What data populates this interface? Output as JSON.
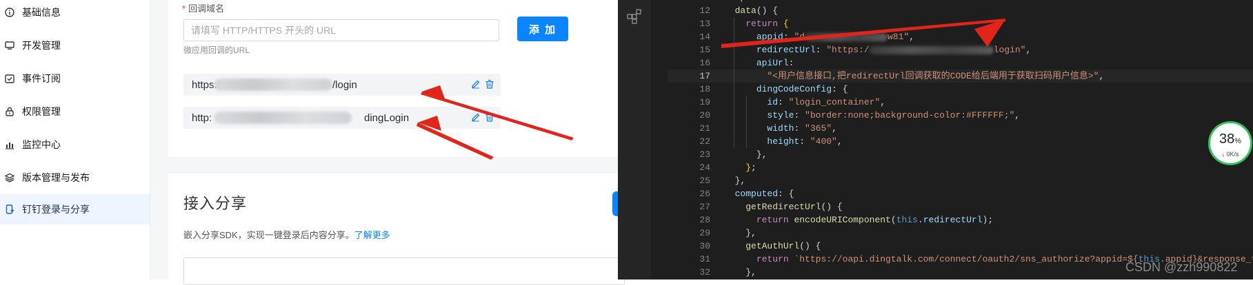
{
  "sidebar": {
    "items": [
      {
        "label": "基础信息",
        "icon": "info-icon"
      },
      {
        "label": "开发管理",
        "icon": "monitor-icon"
      },
      {
        "label": "事件订阅",
        "icon": "calendar-check-icon"
      },
      {
        "label": "权限管理",
        "icon": "lock-icon"
      },
      {
        "label": "监控中心",
        "icon": "bar-chart-icon"
      },
      {
        "label": "版本管理与发布",
        "icon": "layers-icon"
      },
      {
        "label": "钉钉登录与分享",
        "icon": "mobile-share-icon"
      }
    ],
    "active_index": 6
  },
  "callback": {
    "label": "回调域名",
    "required_mark": "*",
    "placeholder": "请填写 HTTP/HTTPS 开头的 URL",
    "add_button": "添 加",
    "hint": "微应用回调的URL",
    "urls": [
      {
        "prefix": "https:/",
        "suffix": "/login"
      },
      {
        "prefix": "http:",
        "suffix": "dingLogin"
      }
    ]
  },
  "share_section": {
    "title": "接入分享",
    "description": "嵌入分享SDK，实现一键登录后内容分享。",
    "link": "了解更多"
  },
  "editor": {
    "lines": [
      {
        "n": "12",
        "parts": [
          [
            "",
            "  "
          ],
          [
            "fn",
            "data"
          ],
          [
            "",
            "() {"
          ]
        ]
      },
      {
        "n": "13",
        "parts": [
          [
            "",
            "    "
          ],
          [
            "kw",
            "return"
          ],
          [
            "",
            " "
          ],
          [
            "br",
            "{"
          ]
        ]
      },
      {
        "n": "14",
        "parts": [
          [
            "",
            "      "
          ],
          [
            "prop",
            "appid"
          ],
          [
            "",
            ": "
          ],
          [
            "str",
            "\"d"
          ],
          [
            "blur",
            "120"
          ],
          [
            "str",
            "w81\""
          ],
          [
            "",
            ","
          ]
        ]
      },
      {
        "n": "15",
        "parts": [
          [
            "",
            "      "
          ],
          [
            "prop",
            "redirectUrl"
          ],
          [
            "",
            ": "
          ],
          [
            "str",
            "\"https:/"
          ],
          [
            "blur",
            "180"
          ],
          [
            "str",
            "login\""
          ],
          [
            "",
            ","
          ]
        ]
      },
      {
        "n": "16",
        "parts": [
          [
            "",
            "      "
          ],
          [
            "prop",
            "apiUrl"
          ],
          [
            "",
            ":"
          ]
        ]
      },
      {
        "n": "17",
        "parts": [
          [
            "",
            "        "
          ],
          [
            "str",
            "\"<用户信息接口,把redirectUrl回调获取的CODE给后端用于获取扫码用户信息>\""
          ],
          [
            "",
            ","
          ]
        ]
      },
      {
        "n": "18",
        "parts": [
          [
            "",
            "      "
          ],
          [
            "prop",
            "dingCodeConfig"
          ],
          [
            "",
            ": {"
          ]
        ]
      },
      {
        "n": "19",
        "parts": [
          [
            "",
            "        "
          ],
          [
            "prop",
            "id"
          ],
          [
            "",
            ": "
          ],
          [
            "str",
            "\"login_container\""
          ],
          [
            "",
            ","
          ]
        ]
      },
      {
        "n": "20",
        "parts": [
          [
            "",
            "        "
          ],
          [
            "prop",
            "style"
          ],
          [
            "",
            ": "
          ],
          [
            "str",
            "\"border:none;background-color:#FFFFFF;\""
          ],
          [
            "",
            ","
          ]
        ]
      },
      {
        "n": "21",
        "parts": [
          [
            "",
            "        "
          ],
          [
            "prop",
            "width"
          ],
          [
            "",
            ": "
          ],
          [
            "str",
            "\"365\""
          ],
          [
            "",
            ","
          ]
        ]
      },
      {
        "n": "22",
        "parts": [
          [
            "",
            "        "
          ],
          [
            "prop",
            "height"
          ],
          [
            "",
            ": "
          ],
          [
            "str",
            "\"400\""
          ],
          [
            "",
            ","
          ]
        ]
      },
      {
        "n": "23",
        "parts": [
          [
            "",
            "      },"
          ]
        ]
      },
      {
        "n": "24",
        "parts": [
          [
            "",
            "    "
          ],
          [
            "br",
            "}"
          ],
          [
            "",
            ";"
          ]
        ]
      },
      {
        "n": "25",
        "parts": [
          [
            "",
            "  },"
          ]
        ]
      },
      {
        "n": "26",
        "parts": [
          [
            "",
            "  "
          ],
          [
            "prop",
            "computed"
          ],
          [
            "",
            ": {"
          ]
        ]
      },
      {
        "n": "27",
        "parts": [
          [
            "",
            "    "
          ],
          [
            "fn",
            "getRedirectUrl"
          ],
          [
            "",
            "() {"
          ]
        ]
      },
      {
        "n": "28",
        "parts": [
          [
            "",
            "      "
          ],
          [
            "kw",
            "return"
          ],
          [
            "",
            " "
          ],
          [
            "fn",
            "encodeURIComponent"
          ],
          [
            "",
            "("
          ],
          [
            "this",
            "this"
          ],
          [
            "",
            "."
          ],
          [
            "prop",
            "redirectUrl"
          ],
          [
            "",
            ");"
          ]
        ]
      },
      {
        "n": "29",
        "parts": [
          [
            "",
            "    },"
          ]
        ]
      },
      {
        "n": "30",
        "parts": [
          [
            "",
            "    "
          ],
          [
            "fn",
            "getAuthUrl"
          ],
          [
            "",
            "() {"
          ]
        ]
      },
      {
        "n": "31",
        "parts": [
          [
            "",
            "      "
          ],
          [
            "kw",
            "return"
          ],
          [
            "",
            " "
          ],
          [
            "str",
            "`https://oapi.dingtalk.com/connect/oauth2/sns_authorize?appid=${"
          ],
          [
            "this",
            "this"
          ],
          [
            "str",
            ".appid}&response_type=co"
          ]
        ]
      },
      {
        "n": "32",
        "parts": [
          [
            "",
            "    },"
          ]
        ]
      }
    ],
    "current_line": "17"
  },
  "gauge": {
    "percent": "38",
    "unit": "%",
    "speed": "0K/s"
  },
  "watermark": "CSDN @zzh990822"
}
